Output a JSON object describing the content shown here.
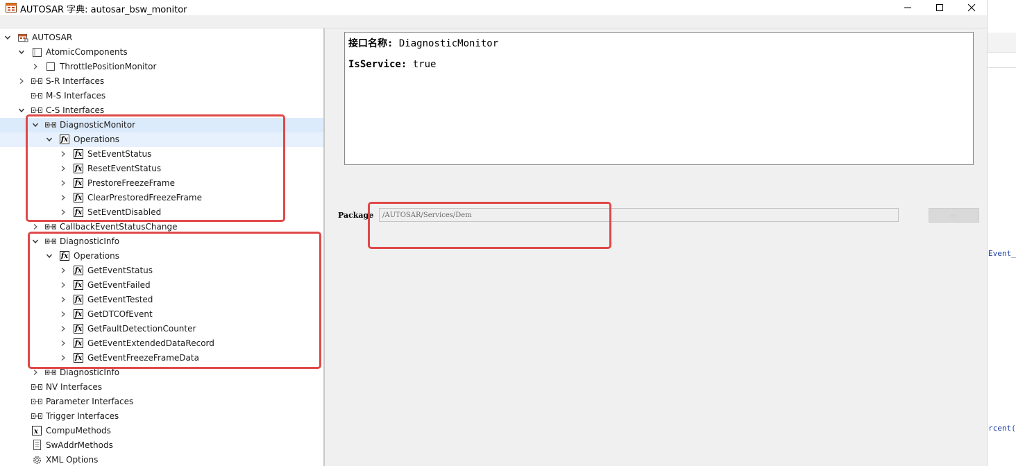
{
  "window": {
    "title": "AUTOSAR 字典: autosar_bsw_monitor",
    "controls": {
      "minimize": "—",
      "maximize": "☐",
      "close": "✕"
    }
  },
  "tree": [
    {
      "id": "autosar",
      "label": "AUTOSAR",
      "level": 0,
      "expanded": true,
      "icon": "autosar-root-icon"
    },
    {
      "id": "atomic",
      "label": "AtomicComponents",
      "level": 1,
      "expanded": true,
      "icon": "folder-box-icon"
    },
    {
      "id": "tpm",
      "label": "ThrottlePositionMonitor",
      "level": 2,
      "expanded": false,
      "icon": "component-box-icon"
    },
    {
      "id": "sr",
      "label": "S-R Interfaces",
      "level": 1,
      "expanded": false,
      "icon": "interface-pair-icon"
    },
    {
      "id": "ms",
      "label": "M-S Interfaces",
      "level": 1,
      "expanded": null,
      "icon": "interface-pair-icon"
    },
    {
      "id": "cs",
      "label": "C-S Interfaces",
      "level": 1,
      "expanded": true,
      "icon": "interface-pair-icon"
    },
    {
      "id": "dm",
      "label": "DiagnosticMonitor",
      "level": 2,
      "expanded": true,
      "icon": "client-server-icon",
      "selected": true
    },
    {
      "id": "dm-ops",
      "label": "Operations",
      "level": 3,
      "expanded": true,
      "icon": "function-icon"
    },
    {
      "id": "op1",
      "label": "SetEventStatus",
      "level": 4,
      "expanded": false,
      "icon": "function-icon"
    },
    {
      "id": "op2",
      "label": "ResetEventStatus",
      "level": 4,
      "expanded": false,
      "icon": "function-icon"
    },
    {
      "id": "op3",
      "label": "PrestoreFreezeFrame",
      "level": 4,
      "expanded": false,
      "icon": "function-icon"
    },
    {
      "id": "op4",
      "label": "ClearPrestoredFreezeFrame",
      "level": 4,
      "expanded": false,
      "icon": "function-icon"
    },
    {
      "id": "op5",
      "label": "SetEventDisabled",
      "level": 4,
      "expanded": false,
      "icon": "function-icon"
    },
    {
      "id": "cb",
      "label": "CallbackEventStatusChange",
      "level": 2,
      "expanded": false,
      "icon": "client-server-icon"
    },
    {
      "id": "di",
      "label": "DiagnosticInfo",
      "level": 2,
      "expanded": true,
      "icon": "client-server-icon"
    },
    {
      "id": "di-ops",
      "label": "Operations",
      "level": 3,
      "expanded": true,
      "icon": "function-icon"
    },
    {
      "id": "op6",
      "label": "GetEventStatus",
      "level": 4,
      "expanded": false,
      "icon": "function-icon"
    },
    {
      "id": "op7",
      "label": "GetEventFailed",
      "level": 4,
      "expanded": false,
      "icon": "function-icon"
    },
    {
      "id": "op8",
      "label": "GetEventTested",
      "level": 4,
      "expanded": false,
      "icon": "function-icon"
    },
    {
      "id": "op9",
      "label": "GetDTCOfEvent",
      "level": 4,
      "expanded": false,
      "icon": "function-icon"
    },
    {
      "id": "op10",
      "label": "GetFaultDetectionCounter",
      "level": 4,
      "expanded": false,
      "icon": "function-icon"
    },
    {
      "id": "op11",
      "label": "GetEventExtendedDataRecord",
      "level": 4,
      "expanded": false,
      "icon": "function-icon"
    },
    {
      "id": "op12",
      "label": "GetEventFreezeFrameData",
      "level": 4,
      "expanded": false,
      "icon": "function-icon"
    },
    {
      "id": "di2",
      "label": "DiagnosticInfo",
      "level": 2,
      "expanded": false,
      "icon": "client-server-icon"
    },
    {
      "id": "nv",
      "label": "NV Interfaces",
      "level": 1,
      "expanded": null,
      "icon": "interface-pair-icon"
    },
    {
      "id": "param",
      "label": "Parameter Interfaces",
      "level": 1,
      "expanded": null,
      "icon": "interface-pair-icon"
    },
    {
      "id": "trig",
      "label": "Trigger Interfaces",
      "level": 1,
      "expanded": null,
      "icon": "interface-pair-icon"
    },
    {
      "id": "compu",
      "label": "CompuMethods",
      "level": 1,
      "expanded": null,
      "icon": "compu-method-icon"
    },
    {
      "id": "swaddr",
      "label": "SwAddrMethods",
      "level": 1,
      "expanded": null,
      "icon": "document-icon"
    },
    {
      "id": "xml",
      "label": "XML Options",
      "level": 1,
      "expanded": null,
      "icon": "gear-icon"
    }
  ],
  "details": {
    "interface_name_label": "接口名称:",
    "interface_name_value": "DiagnosticMonitor",
    "is_service_label": "IsService:",
    "is_service_value": "true",
    "package_label": "Package",
    "package_value": "/AUTOSAR/Services/Dem",
    "browse_button": "..."
  },
  "background_window": {
    "code_fragments": [
      "Event_c",
      "rcent()"
    ]
  },
  "colors": {
    "highlight_red": "#e04848",
    "selection": "#dcebfc"
  }
}
